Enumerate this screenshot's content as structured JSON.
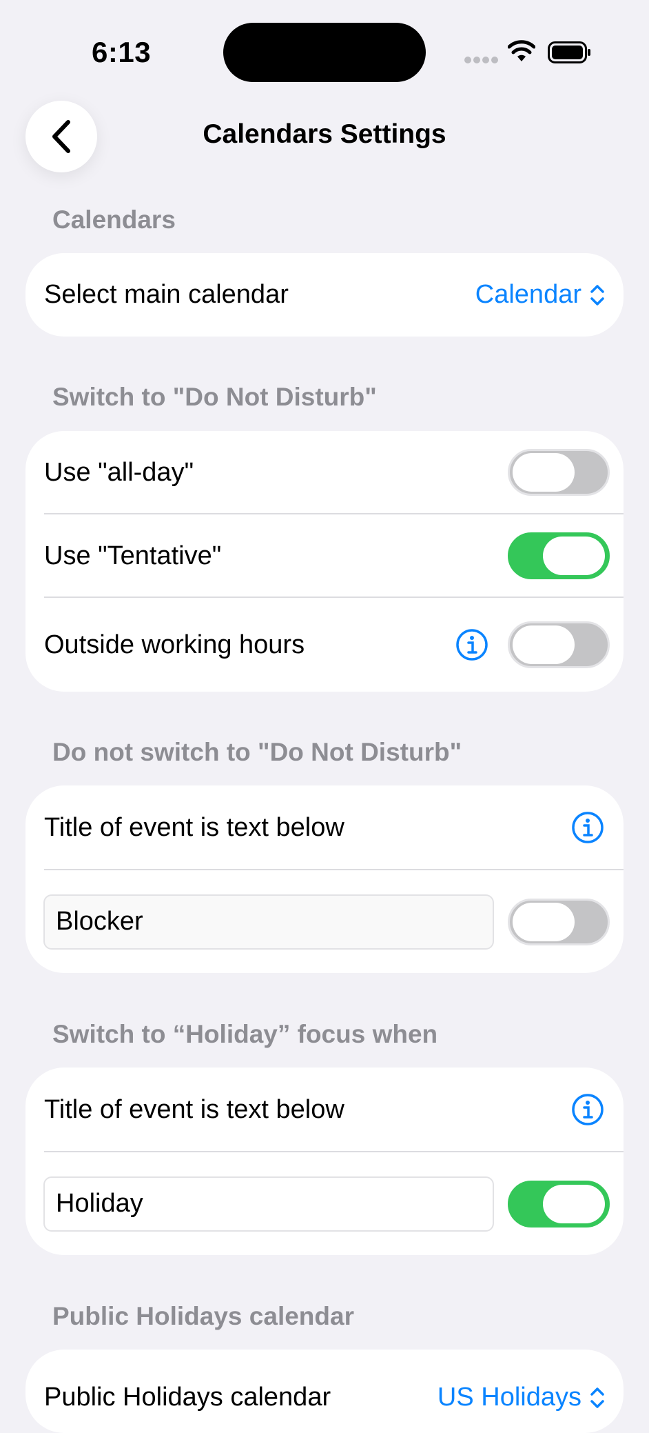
{
  "status_bar": {
    "time": "6:13"
  },
  "nav": {
    "title": "Calendars Settings"
  },
  "calendars": {
    "header": "Calendars",
    "main_calendar_label": "Select main calendar",
    "main_calendar_value": "Calendar"
  },
  "switch_dnd": {
    "header": "Switch to \"Do Not Disturb\"",
    "all_day_label": "Use \"all-day\"",
    "all_day_on": false,
    "tentative_label": "Use \"Tentative\"",
    "tentative_on": true,
    "outside_hours_label": "Outside working hours",
    "outside_hours_on": false
  },
  "no_switch_dnd": {
    "header": "Do not switch to \"Do Not Disturb\"",
    "title_rule_label": "Title of event is text below",
    "text_value": "Blocker",
    "toggle_on": false
  },
  "holiday_focus": {
    "header": "Switch to “Holiday” focus when",
    "title_rule_label": "Title of event is text below",
    "text_value": "Holiday",
    "toggle_on": true
  },
  "public_holidays": {
    "header": "Public Holidays calendar",
    "label": "Public Holidays calendar",
    "value": "US Holidays"
  },
  "colors": {
    "accent": "#0a84ff",
    "toggle_on": "#34c759",
    "toggle_off": "#c4c4c6",
    "background": "#f2f1f6"
  }
}
